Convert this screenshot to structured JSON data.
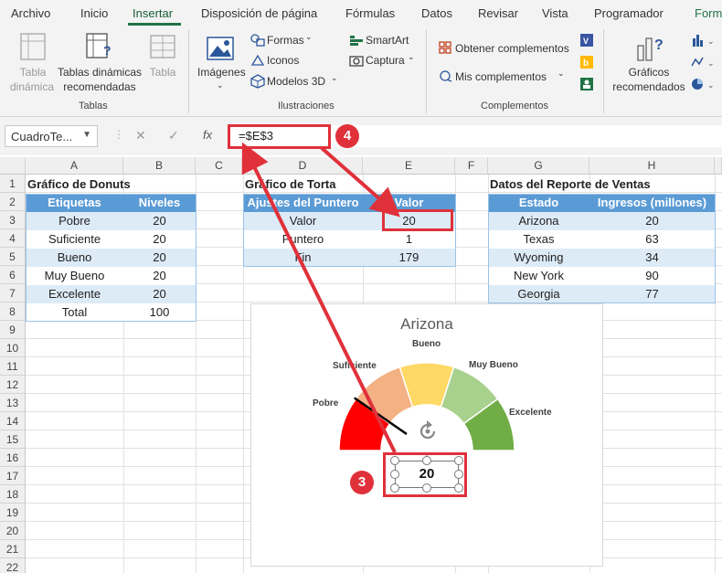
{
  "ribbon_tabs": [
    "Archivo",
    "Inicio",
    "Insertar",
    "Disposición de página",
    "Fórmulas",
    "Datos",
    "Revisar",
    "Vista",
    "Programador",
    "Forma"
  ],
  "active_tab": "Insertar",
  "ribbon": {
    "tablas": {
      "tabla_dinamica": [
        "Tabla",
        "dinámica"
      ],
      "tablas_recomendadas": [
        "Tablas dinámicas",
        "recomendadas"
      ],
      "tabla": "Tabla",
      "group": "Tablas"
    },
    "ilustraciones": {
      "imagenes": "Imágenes",
      "formas": "Formas",
      "iconos": "Iconos",
      "modelos3d": "Modelos 3D",
      "smartart": "SmartArt",
      "captura": "Captura",
      "group": "Ilustraciones"
    },
    "complementos": {
      "obtener": "Obtener complementos",
      "mis": "Mis complementos",
      "group": "Complementos"
    },
    "graficos": {
      "recomendados": [
        "Gráficos",
        "recomendados"
      ]
    }
  },
  "formula_bar": {
    "name_box": "CuadroTe...",
    "cancel": "✕",
    "enter": "✓",
    "fx": "fx",
    "formula": "=$E$3"
  },
  "columns": [
    "A",
    "B",
    "C",
    "D",
    "E",
    "F",
    "G",
    "H"
  ],
  "rows": [
    "1",
    "2",
    "3",
    "4",
    "5",
    "6",
    "7",
    "8",
    "9",
    "10",
    "11",
    "12",
    "13",
    "14",
    "15",
    "16",
    "17",
    "18",
    "19",
    "20",
    "21",
    "22"
  ],
  "donut_table": {
    "title": "Gráfico de Donuts",
    "headers": [
      "Etiquetas",
      "Niveles"
    ],
    "rows": [
      [
        "Pobre",
        "20"
      ],
      [
        "Suficiente",
        "20"
      ],
      [
        "Bueno",
        "20"
      ],
      [
        "Muy Bueno",
        "20"
      ],
      [
        "Excelente",
        "20"
      ],
      [
        "Total",
        "100"
      ]
    ]
  },
  "pie_table": {
    "title": "Gráfico de Torta",
    "headers": [
      "Ajustes del Puntero",
      "Valor"
    ],
    "rows": [
      [
        "Valor",
        "20"
      ],
      [
        "Puntero",
        "1"
      ],
      [
        "Fin",
        "179"
      ]
    ]
  },
  "sales_table": {
    "title": "Datos del Reporte de Ventas",
    "headers": [
      "Estado",
      "Ingresos (millones)"
    ],
    "rows": [
      [
        "Arizona",
        "20"
      ],
      [
        "Texas",
        "63"
      ],
      [
        "Wyoming",
        "34"
      ],
      [
        "New York",
        "90"
      ],
      [
        "Georgia",
        "77"
      ]
    ]
  },
  "gauge": {
    "title": "Arizona",
    "labels": [
      "Pobre",
      "Suficiente",
      "Bueno",
      "Muy Bueno",
      "Excelente"
    ],
    "value_text": "20",
    "pointer_fraction": 0.2,
    "colors": [
      "#ff0000",
      "#f4b183",
      "#ffd966",
      "#a9d18e",
      "#70ad47"
    ]
  },
  "annotations": {
    "badge_3": "3",
    "badge_4": "4"
  }
}
